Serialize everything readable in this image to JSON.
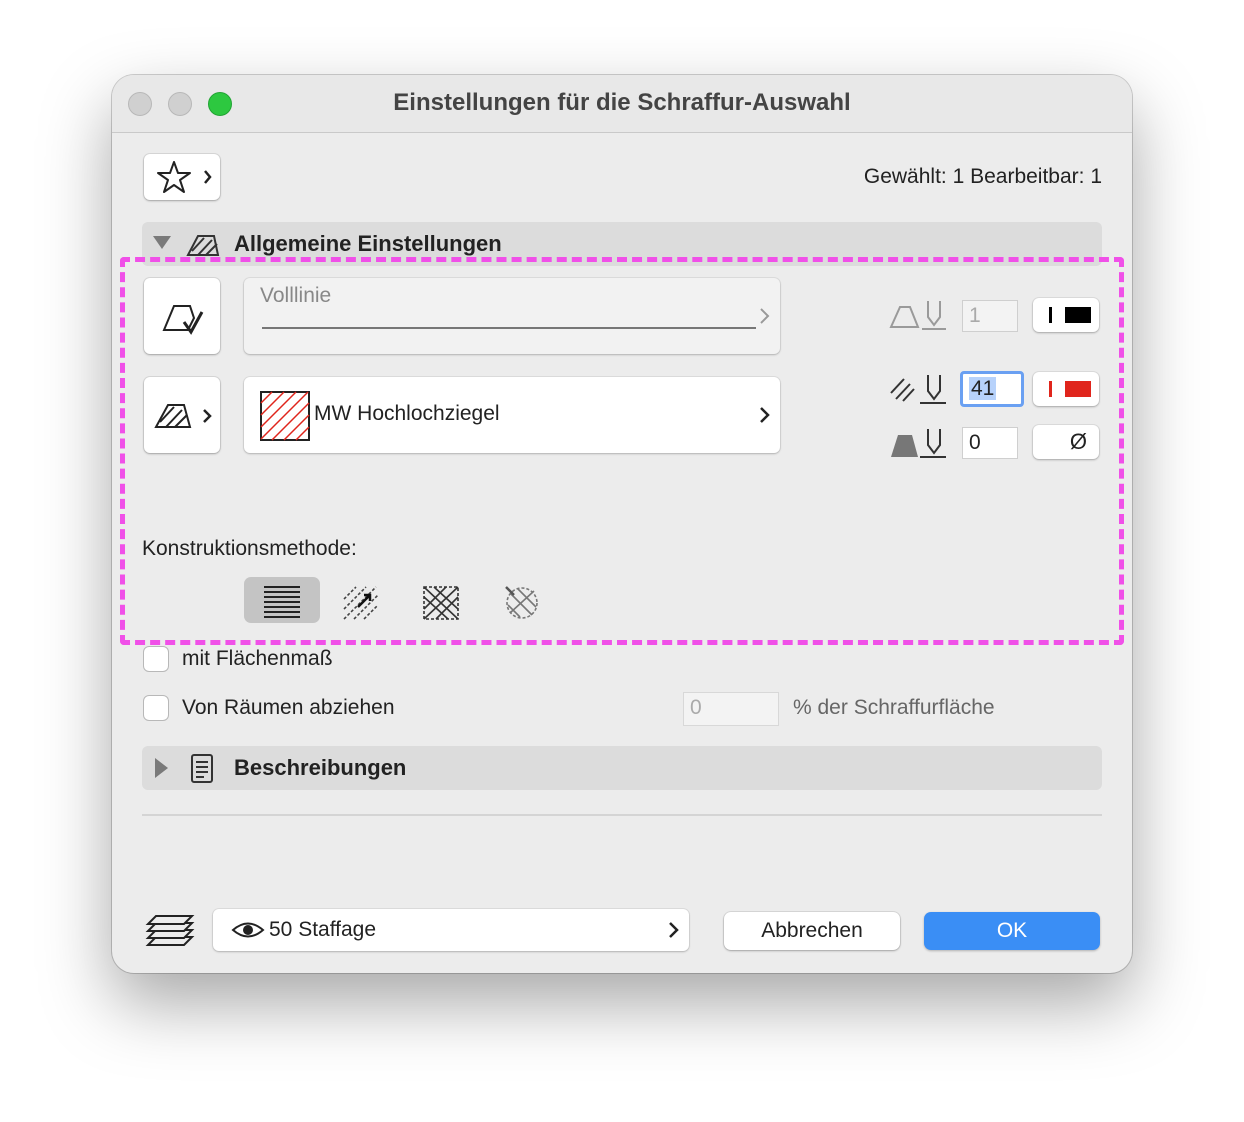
{
  "window": {
    "title": "Einstellungen für die Schraffur-Auswahl"
  },
  "header": {
    "favorites_icon": "star-icon",
    "selection_counts": "Gewählt: 1 Bearbeitbar: 1"
  },
  "general_section": {
    "title": "Allgemeine Einstellungen",
    "line_type": "Volllinie",
    "fill_type": "MW Hochlochziegel",
    "contour_pen_value": "1",
    "fill_pen_value": "41",
    "background_pen_value": "0",
    "background_pen_symbol": "Ø",
    "colors": {
      "contour_pen": "#000000",
      "fill_pen": "#e0251c",
      "accent_highlight": "#f050e8"
    },
    "construction_method_label": "Konstruktionsmethode:",
    "construction_methods": [
      "parallel-lines",
      "rotated-hatch",
      "distorted-hatch",
      "radial-hatch"
    ],
    "selected_method_index": 0
  },
  "options": {
    "area_checkbox_label": "mit Flächenmaß",
    "area_checked": false,
    "subtract_label": "Von Räumen abziehen",
    "subtract_checked": false,
    "subtract_percent_placeholder": "0",
    "subtract_percent_suffix": "% der Schraffurfläche"
  },
  "descriptions_section": {
    "title": "Beschreibungen"
  },
  "footer": {
    "layer_label": "50 Staffage",
    "cancel_label": "Abbrechen",
    "ok_label": "OK",
    "ok_color": "#3a8ef5"
  }
}
